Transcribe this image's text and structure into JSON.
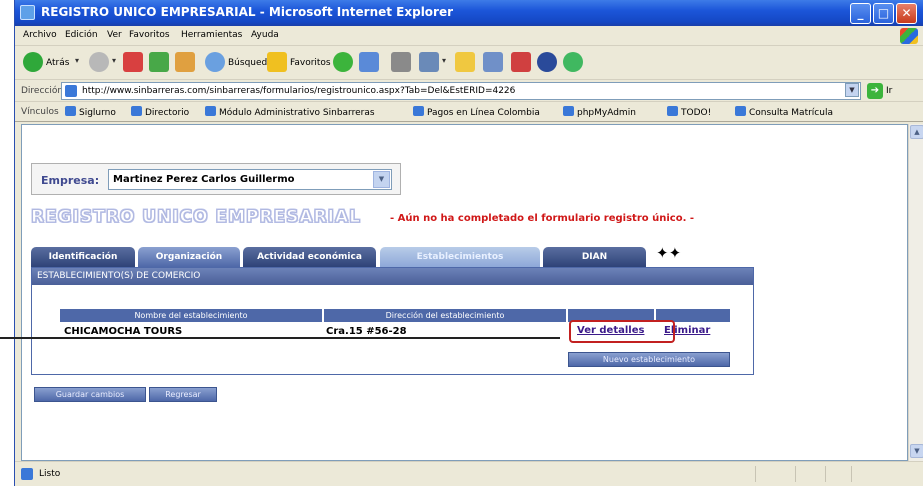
{
  "window": {
    "title": "REGISTRO UNICO EMPRESARIAL - Microsoft Internet Explorer",
    "minimize": "_",
    "maximize": "□",
    "close": "✕"
  },
  "menu": [
    "Archivo",
    "Edición",
    "Ver",
    "Favoritos",
    "Herramientas",
    "Ayuda"
  ],
  "toolbar": {
    "back": "Atrás",
    "search": "Búsqueda",
    "favorites": "Favoritos"
  },
  "address": {
    "label": "Dirección",
    "url": "http://www.sinbarreras.com/sinbarreras/formularios/registrounico.aspx?Tab=Del&EstERID=4226",
    "go": "Ir"
  },
  "links": {
    "label": "Vínculos",
    "items": [
      "Siglurno",
      "Directorio",
      "Módulo Administrativo Sinbarreras",
      "Pagos en Línea Colombia",
      "phpMyAdmin",
      "TODO!",
      "Consulta Matrícula"
    ]
  },
  "empresa": {
    "label": "Empresa:",
    "value": "Martinez Perez Carlos Guillermo"
  },
  "heading": "REGISTRO UNICO EMPRESARIAL",
  "warning": "- Aún no ha completado el formulario registro único. -",
  "tabs": [
    "Identificación",
    "Organización",
    "Actividad económica",
    "Establecimientos",
    "DIAN"
  ],
  "tab_arrows": "✦✦",
  "panel": {
    "title": "ESTABLECIMIENTO(S) DE COMERCIO",
    "columns": [
      "Nombre del establecimiento",
      "Dirección del establecimiento"
    ],
    "rows": [
      {
        "name": "CHICAMOCHA TOURS",
        "address": "Cra.15 #56-28",
        "details": "Ver detalles",
        "delete": "Eliminar"
      }
    ],
    "new_button": "Nuevo establecimiento"
  },
  "buttons": {
    "save": "Guardar cambios",
    "back": "Regresar"
  },
  "status": {
    "text": "Listo"
  }
}
